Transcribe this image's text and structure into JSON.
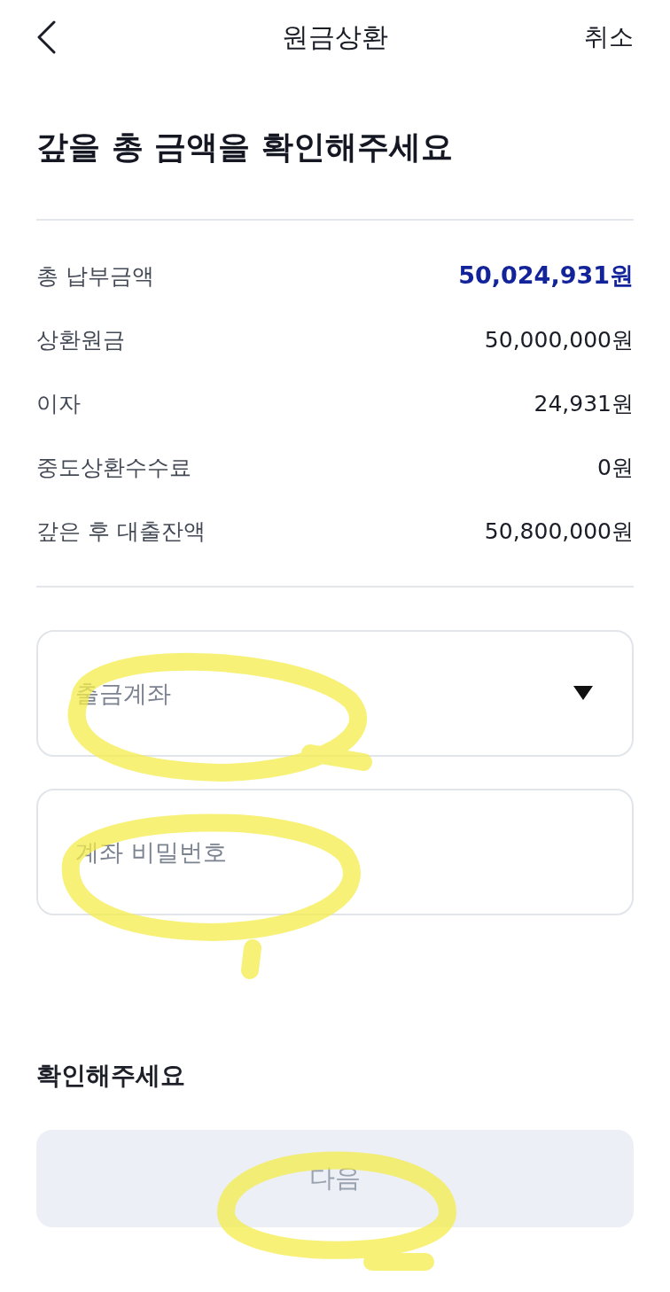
{
  "header": {
    "title": "원금상환",
    "cancel": "취소"
  },
  "heading": "갚을 총 금액을 확인해주세요",
  "summary": [
    {
      "label": "총 납부금액",
      "value": "50,024,931원",
      "emphasis": true
    },
    {
      "label": "상환원금",
      "value": "50,000,000원",
      "emphasis": false
    },
    {
      "label": "이자",
      "value": "24,931원",
      "emphasis": false
    },
    {
      "label": "중도상환수수료",
      "value": "0원",
      "emphasis": false
    },
    {
      "label": "갚은 후 대출잔액",
      "value": "50,800,000원",
      "emphasis": false
    }
  ],
  "fields": [
    {
      "kind": "select",
      "placeholder": "출금계좌"
    },
    {
      "kind": "password",
      "placeholder": "계좌 비밀번호"
    }
  ],
  "notice_title": "확인해주세요",
  "next_button": {
    "label": "다음",
    "disabled": true
  }
}
